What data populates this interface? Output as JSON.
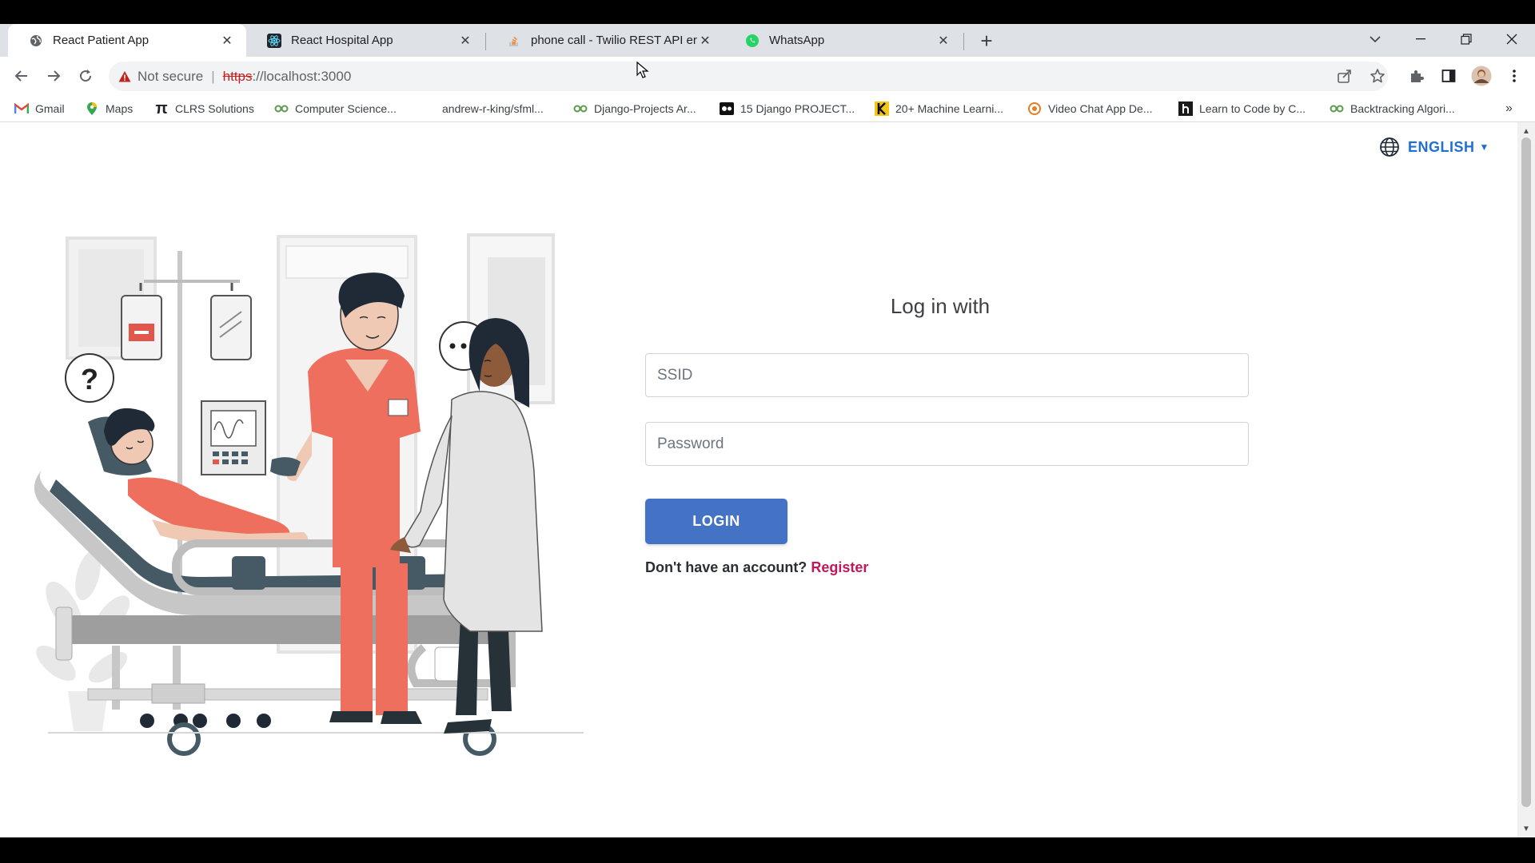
{
  "browser": {
    "tabs": [
      {
        "title": "React Patient App",
        "active": true,
        "icon": "globe-icon"
      },
      {
        "title": "React Hospital App",
        "active": false,
        "icon": "react-icon"
      },
      {
        "title": "phone call - Twilio REST API error",
        "active": false,
        "icon": "stackoverflow-icon"
      },
      {
        "title": "WhatsApp",
        "active": false,
        "icon": "whatsapp-icon"
      }
    ],
    "address": {
      "security_label": "Not secure",
      "scheme": "https",
      "rest": "://localhost:3000"
    },
    "bookmarks": [
      {
        "label": "Gmail",
        "icon": "gmail-icon"
      },
      {
        "label": "Maps",
        "icon": "maps-icon"
      },
      {
        "label": "CLRS Solutions",
        "icon": "pi-icon"
      },
      {
        "label": "Computer Science...",
        "icon": "github-pages-icon"
      },
      {
        "label": "andrew-r-king/sfml...",
        "icon": "github-icon"
      },
      {
        "label": "Django-Projects Ar...",
        "icon": "github-pages-icon"
      },
      {
        "label": "15 Django PROJECT...",
        "icon": "video-icon"
      },
      {
        "label": "20+ Machine Learni...",
        "icon": "k-icon"
      },
      {
        "label": "Video Chat App De...",
        "icon": "chat-icon"
      },
      {
        "label": "Learn to Code by C...",
        "icon": "h-icon"
      },
      {
        "label": "Backtracking Algori...",
        "icon": "github-pages-icon"
      }
    ],
    "overflow": "»"
  },
  "page": {
    "language": "ENGLISH",
    "form": {
      "title": "Log in with",
      "ssid_placeholder": "SSID",
      "password_placeholder": "Password",
      "login_label": "LOGIN",
      "no_account_text": "Don't have an account?",
      "register_label": "Register"
    },
    "colors": {
      "accent": "#4472c4",
      "link": "#1f6fd4",
      "register": "#c2185b",
      "scrub_red": "#ef6f5e",
      "bed_dark": "#455a64"
    }
  }
}
